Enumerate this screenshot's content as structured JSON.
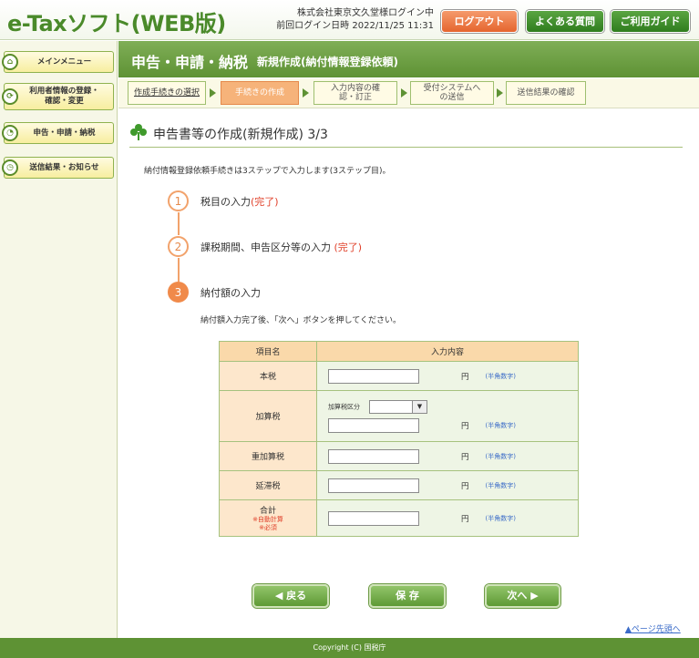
{
  "header": {
    "logo": "e-Taxソフト(WEB版)",
    "user_line1": "株式会社東京文久堂様ログイン中",
    "user_line2": "前回ログイン日時 2022/11/25 11:31",
    "logout": "ログアウト",
    "faq": "よくある質問",
    "guide": "ご利用ガイド"
  },
  "sidebar": {
    "items": [
      {
        "label": "メインメニュー"
      },
      {
        "label": "利用者情報の登録・確認・変更"
      },
      {
        "label": "申告・申請・納税"
      },
      {
        "label": "送信結果・お知らせ"
      }
    ]
  },
  "titlebar": {
    "title": "申告・申請・納税",
    "subtitle": "新規作成(納付情報登録依頼)"
  },
  "steps": [
    {
      "label": "作成手続きの選択"
    },
    {
      "label": "手続きの作成"
    },
    {
      "label": "入力内容の確認・訂正"
    },
    {
      "label": "受付システムへの送信"
    },
    {
      "label": "送信結果の確認"
    }
  ],
  "section_title": "申告書等の作成(新規作成) 3/3",
  "intro": "納付情報登録依頼手続きは3ステップで入力します(3ステップ目)。",
  "progress": [
    {
      "num": "1",
      "label": "税目の入力",
      "status": "(完了)"
    },
    {
      "num": "2",
      "label": "課税期間、申告区分等の入力",
      "status": "(完了)"
    },
    {
      "num": "3",
      "label": "納付額の入力",
      "status": ""
    }
  ],
  "note": "納付額入力完了後、「次へ」ボタンを押してください。",
  "table": {
    "col1": "項目名",
    "col2": "入力内容",
    "rows": [
      {
        "label": "本税",
        "unit": "円",
        "hint": "(半角数字)"
      },
      {
        "label": "加算税",
        "sub_label": "加算税区分",
        "unit": "円",
        "hint": "(半角数字)"
      },
      {
        "label": "重加算税",
        "unit": "円",
        "hint": "(半角数字)"
      },
      {
        "label": "延滞税",
        "unit": "円",
        "hint": "(半角数字)"
      },
      {
        "label": "合計",
        "note1": "※自動計算",
        "note2": "※必須",
        "unit": "円",
        "hint": "(半角数字)"
      }
    ]
  },
  "buttons": {
    "back": "戻る",
    "save": "保 存",
    "next": "次へ"
  },
  "page_top": "ページ先頭へ",
  "footer": "Copyright (C) 国税庁",
  "colors": {
    "brand_green": "#5e9234",
    "accent_orange": "#f08a4a"
  }
}
